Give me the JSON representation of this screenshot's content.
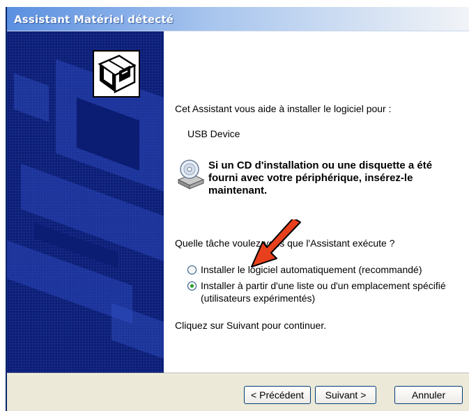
{
  "window": {
    "title": "Assistant Matériel détecté"
  },
  "sidebar": {
    "icon": "hardware-wizard-icon"
  },
  "main": {
    "intro": "Cet Assistant vous aide à installer le logiciel pour :",
    "device_name": "USB Device",
    "cd_icon": "cd-drive-icon",
    "cd_message": "Si un CD d'installation ou une disquette a été fourni avec votre périphérique, insérez-le maintenant.",
    "question": "Quelle tâche voulez-vous que l'Assistant exécute ?",
    "options": [
      {
        "label": "Installer le logiciel automatiquement (recommandé)",
        "selected": false
      },
      {
        "label": "Installer à partir d'une liste ou d'un emplacement spécifié",
        "label_line2": "(utilisateurs expérimentés)",
        "selected": true
      }
    ],
    "continue_text": "Cliquez sur Suivant pour continuer.",
    "annotation": "red-arrow"
  },
  "buttons": {
    "back": "< Précédent",
    "next": "Suivant >",
    "cancel": "Annuler"
  },
  "colors": {
    "sidebar": "#0b1c73",
    "titlebar_start": "#5a8fe0",
    "arrow": "#e8401c",
    "radio_selected": "#21a121"
  }
}
